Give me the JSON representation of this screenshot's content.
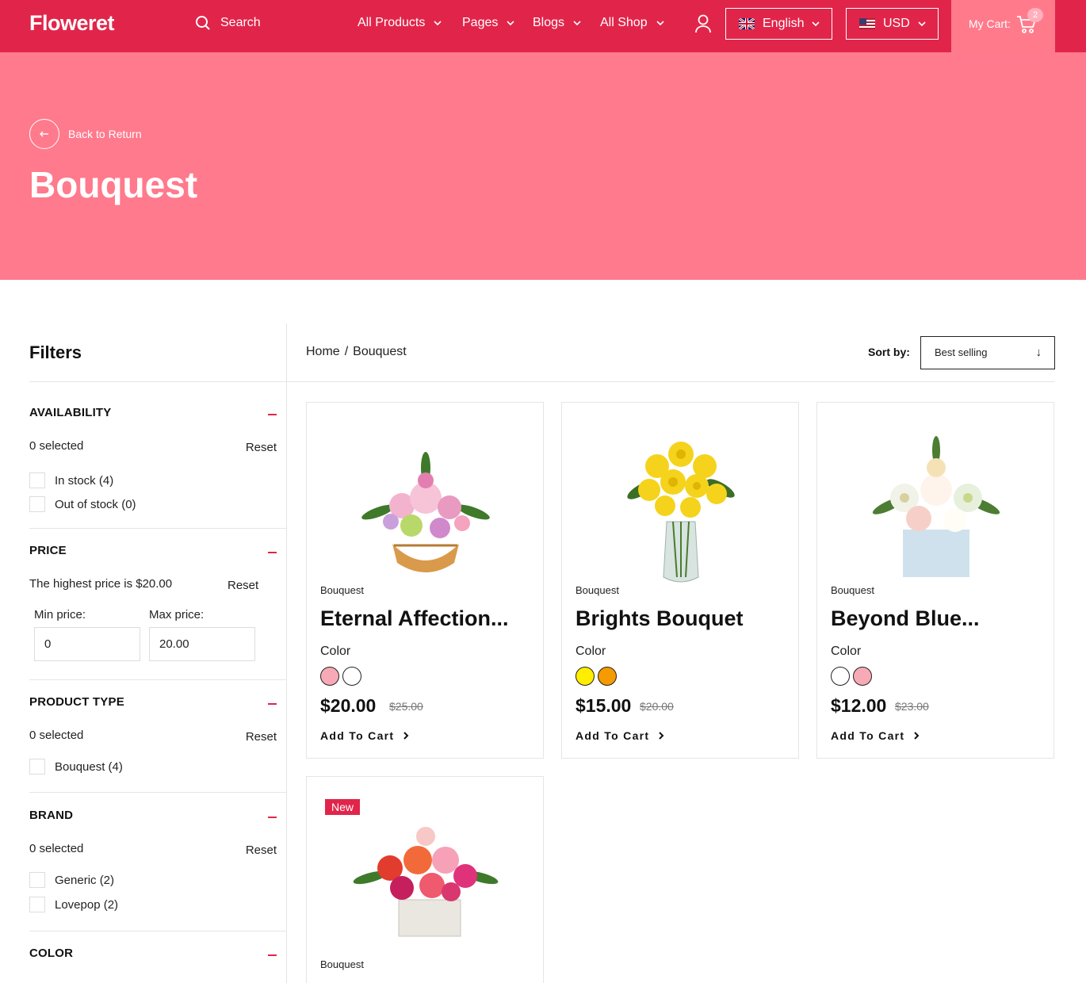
{
  "header": {
    "logo": "Floweret",
    "search_label": "Search",
    "nav": [
      "All Products",
      "Pages",
      "Blogs",
      "All Shop"
    ],
    "language": "English",
    "currency": "USD",
    "cart_label": "My Cart:",
    "cart_count": "2"
  },
  "hero": {
    "back_label": "Back to Return",
    "title": "Bouquest"
  },
  "sidebar": {
    "title": "Filters",
    "availability": {
      "heading": "AVAILABILITY",
      "selected": "0 selected",
      "reset": "Reset",
      "options": [
        "In stock (4)",
        "Out of stock (0)"
      ]
    },
    "price": {
      "heading": "PRICE",
      "highest": "The highest price is $20.00",
      "reset": "Reset",
      "min_label": "Min price:",
      "max_label": "Max price:",
      "min_value": "0",
      "max_value": "20.00"
    },
    "product_type": {
      "heading": "PRODUCT TYPE",
      "selected": "0 selected",
      "reset": "Reset",
      "options": [
        "Bouquest (4)"
      ]
    },
    "brand": {
      "heading": "BRAND",
      "selected": "0 selected",
      "reset": "Reset",
      "options": [
        "Generic (2)",
        "Lovepop (2)"
      ]
    },
    "color": {
      "heading": "COLOR"
    }
  },
  "main": {
    "breadcrumb": [
      "Home",
      "Bouquest"
    ],
    "breadcrumb_sep": "/",
    "sort_label": "Sort by:",
    "sort_value": "Best selling"
  },
  "products": [
    {
      "category": "Bouquest",
      "name": "Eternal Affection...",
      "color_label": "Color",
      "swatches": [
        "#f7aab5",
        "#ffffff"
      ],
      "price": "$20.00",
      "old_price": "$25.00",
      "cta": "Add To Cart"
    },
    {
      "category": "Bouquest",
      "name": "Brights Bouquet",
      "color_label": "Color",
      "swatches": [
        "#ffee00",
        "#f59a00"
      ],
      "price": "$15.00",
      "old_price": "$20.00",
      "cta": "Add To Cart"
    },
    {
      "category": "Bouquest",
      "name": "Beyond Blue...",
      "color_label": "Color",
      "swatches": [
        "#ffffff",
        "#f7aab5"
      ],
      "price": "$12.00",
      "old_price": "$23.00",
      "cta": "Add To Cart"
    },
    {
      "badge": "New",
      "category": "Bouquest"
    }
  ],
  "colors": {
    "brand_red": "#e1254a",
    "hero_pink": "#ff7a8c"
  }
}
